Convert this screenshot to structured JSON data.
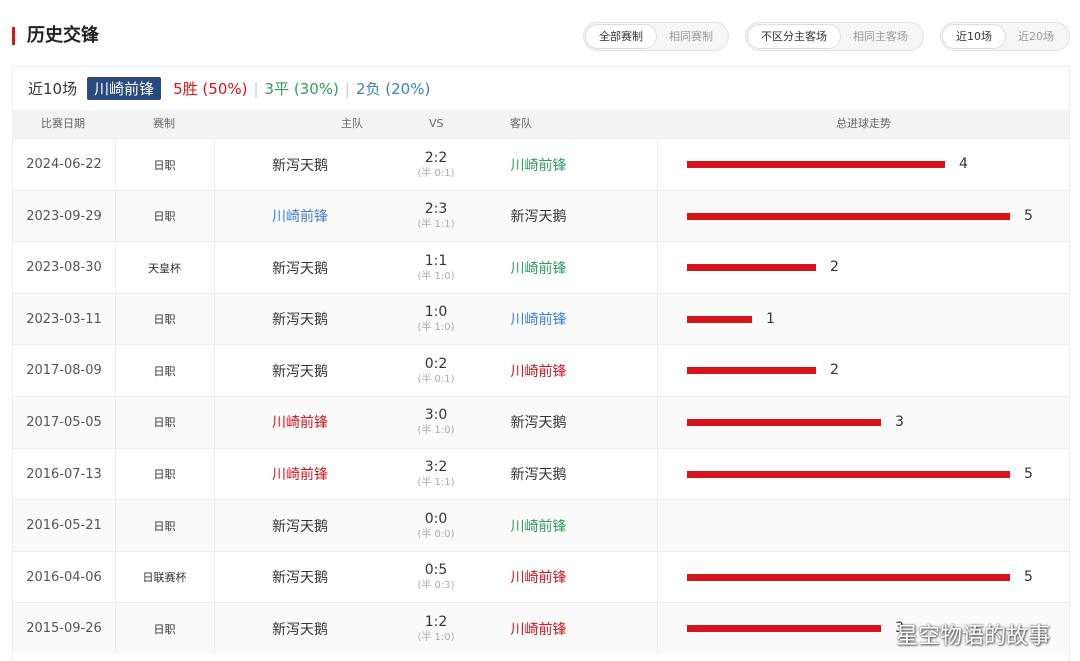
{
  "header": {
    "title": "历史交锋",
    "filters": [
      {
        "options": [
          "全部赛制",
          "相同赛制"
        ],
        "active": 0
      },
      {
        "options": [
          "不区分主客场",
          "相同主客场"
        ],
        "active": 0
      },
      {
        "options": [
          "近10场",
          "近20场"
        ],
        "active": 0
      }
    ]
  },
  "summary": {
    "label": "近10场",
    "team": "川崎前锋",
    "win": "5胜 (50%)",
    "draw": "3平 (30%)",
    "loss": "2负 (20%)",
    "separator": "|"
  },
  "table": {
    "columns": [
      "比赛日期",
      "赛制",
      "主队",
      "VS",
      "客队",
      "总进球走势"
    ],
    "rows": [
      {
        "date": "2024-06-22",
        "comp": "日职",
        "home": "新泻天鹅",
        "home_color": "black",
        "score": "2:2",
        "half": "(半 0:1)",
        "away": "川崎前锋",
        "away_color": "green",
        "goals": 4
      },
      {
        "date": "2023-09-29",
        "comp": "日职",
        "home": "川崎前锋",
        "home_color": "blue",
        "score": "2:3",
        "half": "(半 1:1)",
        "away": "新泻天鹅",
        "away_color": "black",
        "goals": 5
      },
      {
        "date": "2023-08-30",
        "comp": "天皇杯",
        "home": "新泻天鹅",
        "home_color": "black",
        "score": "1:1",
        "half": "(半 1:0)",
        "away": "川崎前锋",
        "away_color": "green",
        "goals": 2
      },
      {
        "date": "2023-03-11",
        "comp": "日职",
        "home": "新泻天鹅",
        "home_color": "black",
        "score": "1:0",
        "half": "(半 1:0)",
        "away": "川崎前锋",
        "away_color": "blue",
        "goals": 1
      },
      {
        "date": "2017-08-09",
        "comp": "日职",
        "home": "新泻天鹅",
        "home_color": "black",
        "score": "0:2",
        "half": "(半 0:1)",
        "away": "川崎前锋",
        "away_color": "red",
        "goals": 2
      },
      {
        "date": "2017-05-05",
        "comp": "日职",
        "home": "川崎前锋",
        "home_color": "red",
        "score": "3:0",
        "half": "(半 1:0)",
        "away": "新泻天鹅",
        "away_color": "black",
        "goals": 3
      },
      {
        "date": "2016-07-13",
        "comp": "日职",
        "home": "川崎前锋",
        "home_color": "red",
        "score": "3:2",
        "half": "(半 1:1)",
        "away": "新泻天鹅",
        "away_color": "black",
        "goals": 5
      },
      {
        "date": "2016-05-21",
        "comp": "日职",
        "home": "新泻天鹅",
        "home_color": "black",
        "score": "0:0",
        "half": "(半 0:0)",
        "away": "川崎前锋",
        "away_color": "green",
        "goals": 0
      },
      {
        "date": "2016-04-06",
        "comp": "日联赛杯",
        "home": "新泻天鹅",
        "home_color": "black",
        "score": "0:5",
        "half": "(半 0:3)",
        "away": "川崎前锋",
        "away_color": "red",
        "goals": 5
      },
      {
        "date": "2015-09-26",
        "comp": "日职",
        "home": "新泻天鹅",
        "home_color": "black",
        "score": "1:2",
        "half": "(半 1:0)",
        "away": "川崎前锋",
        "away_color": "red",
        "goals": 3
      }
    ]
  },
  "colors": {
    "red": "#d6141c",
    "green": "#2e9d5e",
    "blue": "#3a7ed8",
    "black": "#333333",
    "tag": "#2a4a7f"
  },
  "watermark": "星空物语的故事"
}
